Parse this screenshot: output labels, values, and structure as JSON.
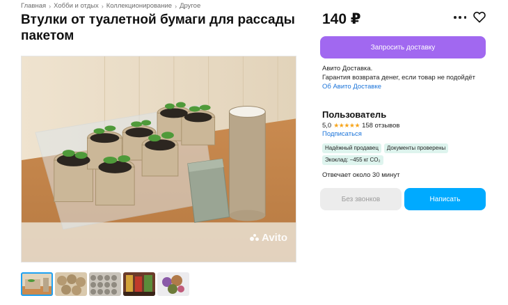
{
  "breadcrumbs": [
    "Главная",
    "Хобби и отдых",
    "Коллекционирование",
    "Другое"
  ],
  "title": "Втулки от туалетной бумаги для рассады пакетом",
  "price": "140 ₽",
  "icons": {
    "more": "more-dots-icon",
    "favorite": "heart-icon",
    "breadcrumb_separator": "chevron-right-icon"
  },
  "delivery": {
    "button_label": "Запросить доставку",
    "line1": "Авито Доставка.",
    "line2": "Гарантия возврата денег, если товар не подойдёт",
    "link": "Об Авито Доставке"
  },
  "seller": {
    "name": "Пользователь",
    "rating": "5,0",
    "stars": "★★★★★",
    "reviews": "158 отзывов",
    "subscribe": "Подписаться",
    "badges": [
      "Надёжный продавец",
      "Документы проверены",
      "Экоклад: −455 кг CO₂"
    ],
    "reply_time": "Отвечает около 30 минут"
  },
  "actions": {
    "no_calls": "Без звонков",
    "write": "Написать"
  },
  "gallery": {
    "watermark": "Avito",
    "thumbnail_count": 5,
    "active_index": 0
  },
  "colors": {
    "delivery_button": "#a168f0",
    "write_button": "#00aaff",
    "link": "#1a73d9",
    "badge_bg": "#def4ee",
    "stars": "#f7a51b"
  }
}
